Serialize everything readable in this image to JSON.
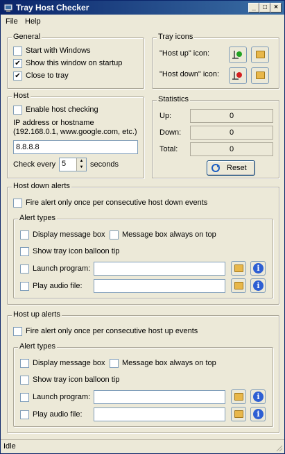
{
  "window": {
    "title": "Tray Host Checker"
  },
  "menu": {
    "file": "File",
    "help": "Help"
  },
  "general": {
    "title": "General",
    "start_with_windows": {
      "label": "Start with Windows",
      "checked": false
    },
    "show_on_startup": {
      "label": "Show this window on startup",
      "checked": true
    },
    "close_to_tray": {
      "label": "Close to tray",
      "checked": true
    }
  },
  "tray_icons": {
    "title": "Tray icons",
    "host_up_label": "\"Host up\" icon:",
    "host_down_label": "\"Host down\" icon:",
    "colors": {
      "up_dot": "#22a222",
      "down_dot": "#d42020"
    }
  },
  "host": {
    "title": "Host",
    "enable_checking": {
      "label": "Enable host checking",
      "checked": false
    },
    "address_label_line1": "IP address or hostname",
    "address_label_line2": "(192.168.0.1, www.google.com, etc.)",
    "address_value": "8.8.8.8",
    "check_every_label": "Check every",
    "check_every_value": "5",
    "seconds_label": "seconds"
  },
  "statistics": {
    "title": "Statistics",
    "up_label": "Up:",
    "up_value": "0",
    "down_label": "Down:",
    "down_value": "0",
    "total_label": "Total:",
    "total_value": "0",
    "reset_label": "Reset"
  },
  "host_down_alerts": {
    "title": "Host down alerts",
    "fire_once": {
      "label": "Fire alert only once per consecutive host down events",
      "checked": false
    },
    "alert_types": {
      "title": "Alert types",
      "display_message_box": "Display message box",
      "message_box_on_top": "Message box always on top",
      "show_balloon": "Show tray icon balloon tip",
      "launch_program": "Launch program:",
      "launch_program_value": "",
      "play_audio": "Play audio file:",
      "play_audio_value": ""
    }
  },
  "host_up_alerts": {
    "title": "Host up alerts",
    "fire_once": {
      "label": "Fire alert only once per consecutive host up events",
      "checked": false
    },
    "alert_types": {
      "title": "Alert types",
      "display_message_box": "Display message box",
      "message_box_on_top": "Message box always on top",
      "show_balloon": "Show tray icon balloon tip",
      "launch_program": "Launch program:",
      "launch_program_value": "",
      "play_audio": "Play audio file:",
      "play_audio_value": ""
    }
  },
  "status": {
    "text": "Idle"
  },
  "icons": {
    "folder": "folder-icon",
    "info": "info-icon",
    "reset": "reset-icon",
    "tray_up": "tray-up-icon",
    "tray_down": "tray-down-icon"
  }
}
